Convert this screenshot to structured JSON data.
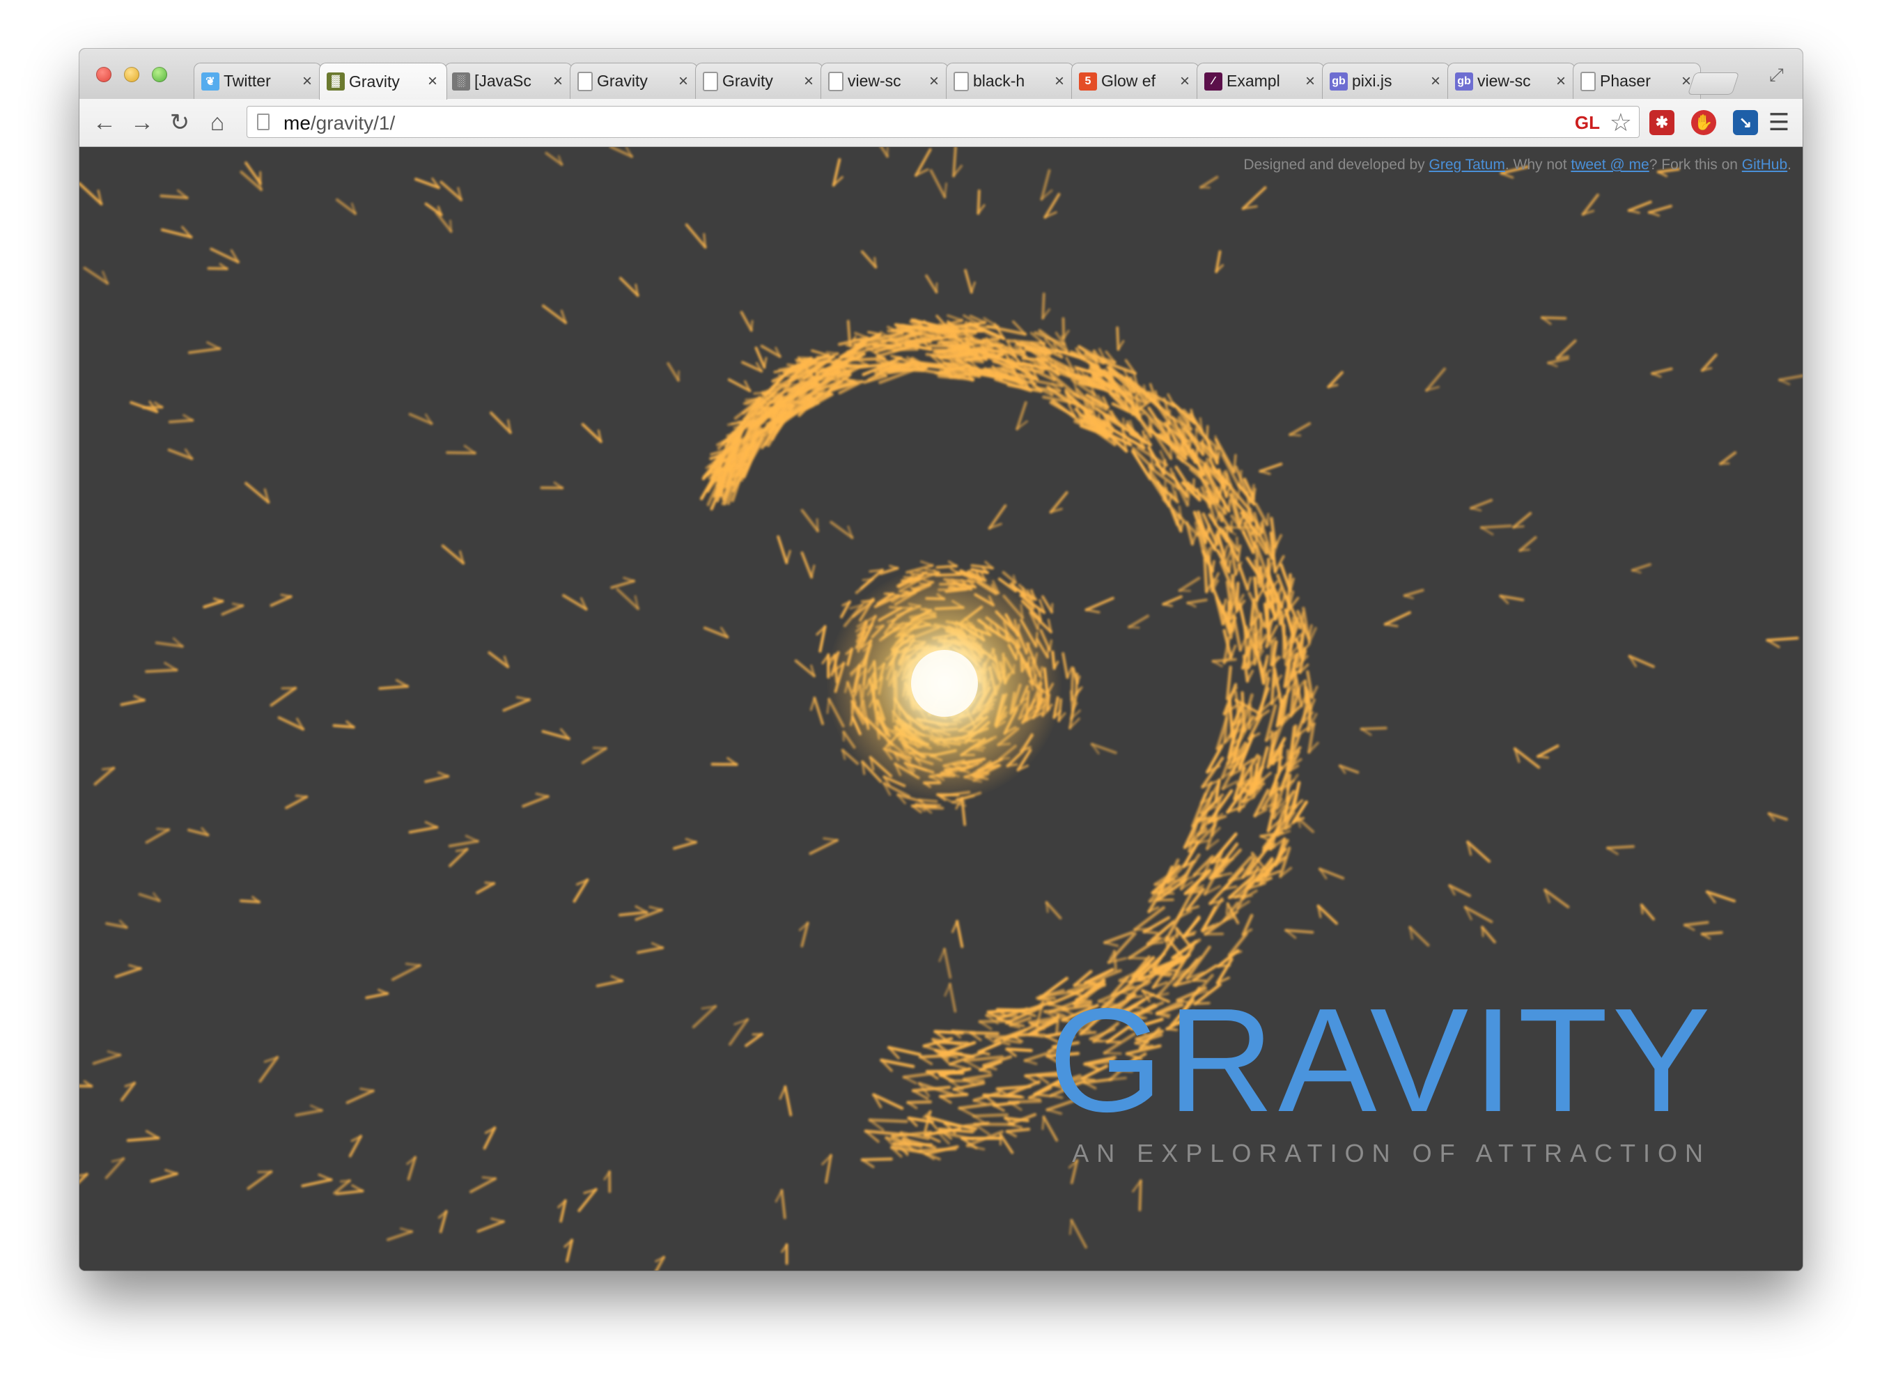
{
  "browser": {
    "tabs": [
      {
        "label": "Twitter",
        "icon": "twitter-bird-icon",
        "color": "#55acee",
        "glyph": "❦"
      },
      {
        "label": "Gravity",
        "icon": "pixel-art-favicon-icon",
        "color": "#6b7a2f",
        "glyph": "▓",
        "active": true
      },
      {
        "label": "[JavaSc",
        "icon": "grid-favicon-icon",
        "color": "#777777",
        "glyph": "░"
      },
      {
        "label": "Gravity",
        "icon": "page-icon",
        "color": "#ffffff",
        "glyph": ""
      },
      {
        "label": "Gravity",
        "icon": "page-icon",
        "color": "#ffffff",
        "glyph": ""
      },
      {
        "label": "view-sc",
        "icon": "page-icon",
        "color": "#ffffff",
        "glyph": ""
      },
      {
        "label": "black-h",
        "icon": "page-icon",
        "color": "#ffffff",
        "glyph": ""
      },
      {
        "label": "Glow ef",
        "icon": "html5-icon",
        "color": "#e44d26",
        "glyph": "5"
      },
      {
        "label": "Exampl",
        "icon": "feather-icon",
        "color": "#5b0f4a",
        "glyph": "∕"
      },
      {
        "label": "pixi.js",
        "icon": "gb-favicon-icon",
        "color": "#6d6dd1",
        "glyph": "gb"
      },
      {
        "label": "view-sc",
        "icon": "gb-favicon-icon",
        "color": "#6d6dd1",
        "glyph": "gb"
      },
      {
        "label": "Phaser",
        "icon": "page-icon",
        "color": "#ffffff",
        "glyph": ""
      }
    ],
    "url_host": "me",
    "url_path": "/gravity/1/",
    "gl_badge": "GL"
  },
  "page": {
    "credit_prefix": "Designed and developed by ",
    "credit_author": "Greg Tatum",
    "credit_mid": ". Why not ",
    "credit_tweet": "tweet @ me",
    "credit_mid2": "? Fork this on ",
    "credit_github": "GitHub",
    "credit_end": ".",
    "title": "GRAVITY",
    "subtitle": "AN EXPLORATION OF ATTRACTION"
  },
  "colors": {
    "background": "#3e3e3e",
    "particle": "#ffb84d",
    "core": "#fffbe0",
    "title": "#4a94dd",
    "subtitle": "#8b8b8b"
  }
}
